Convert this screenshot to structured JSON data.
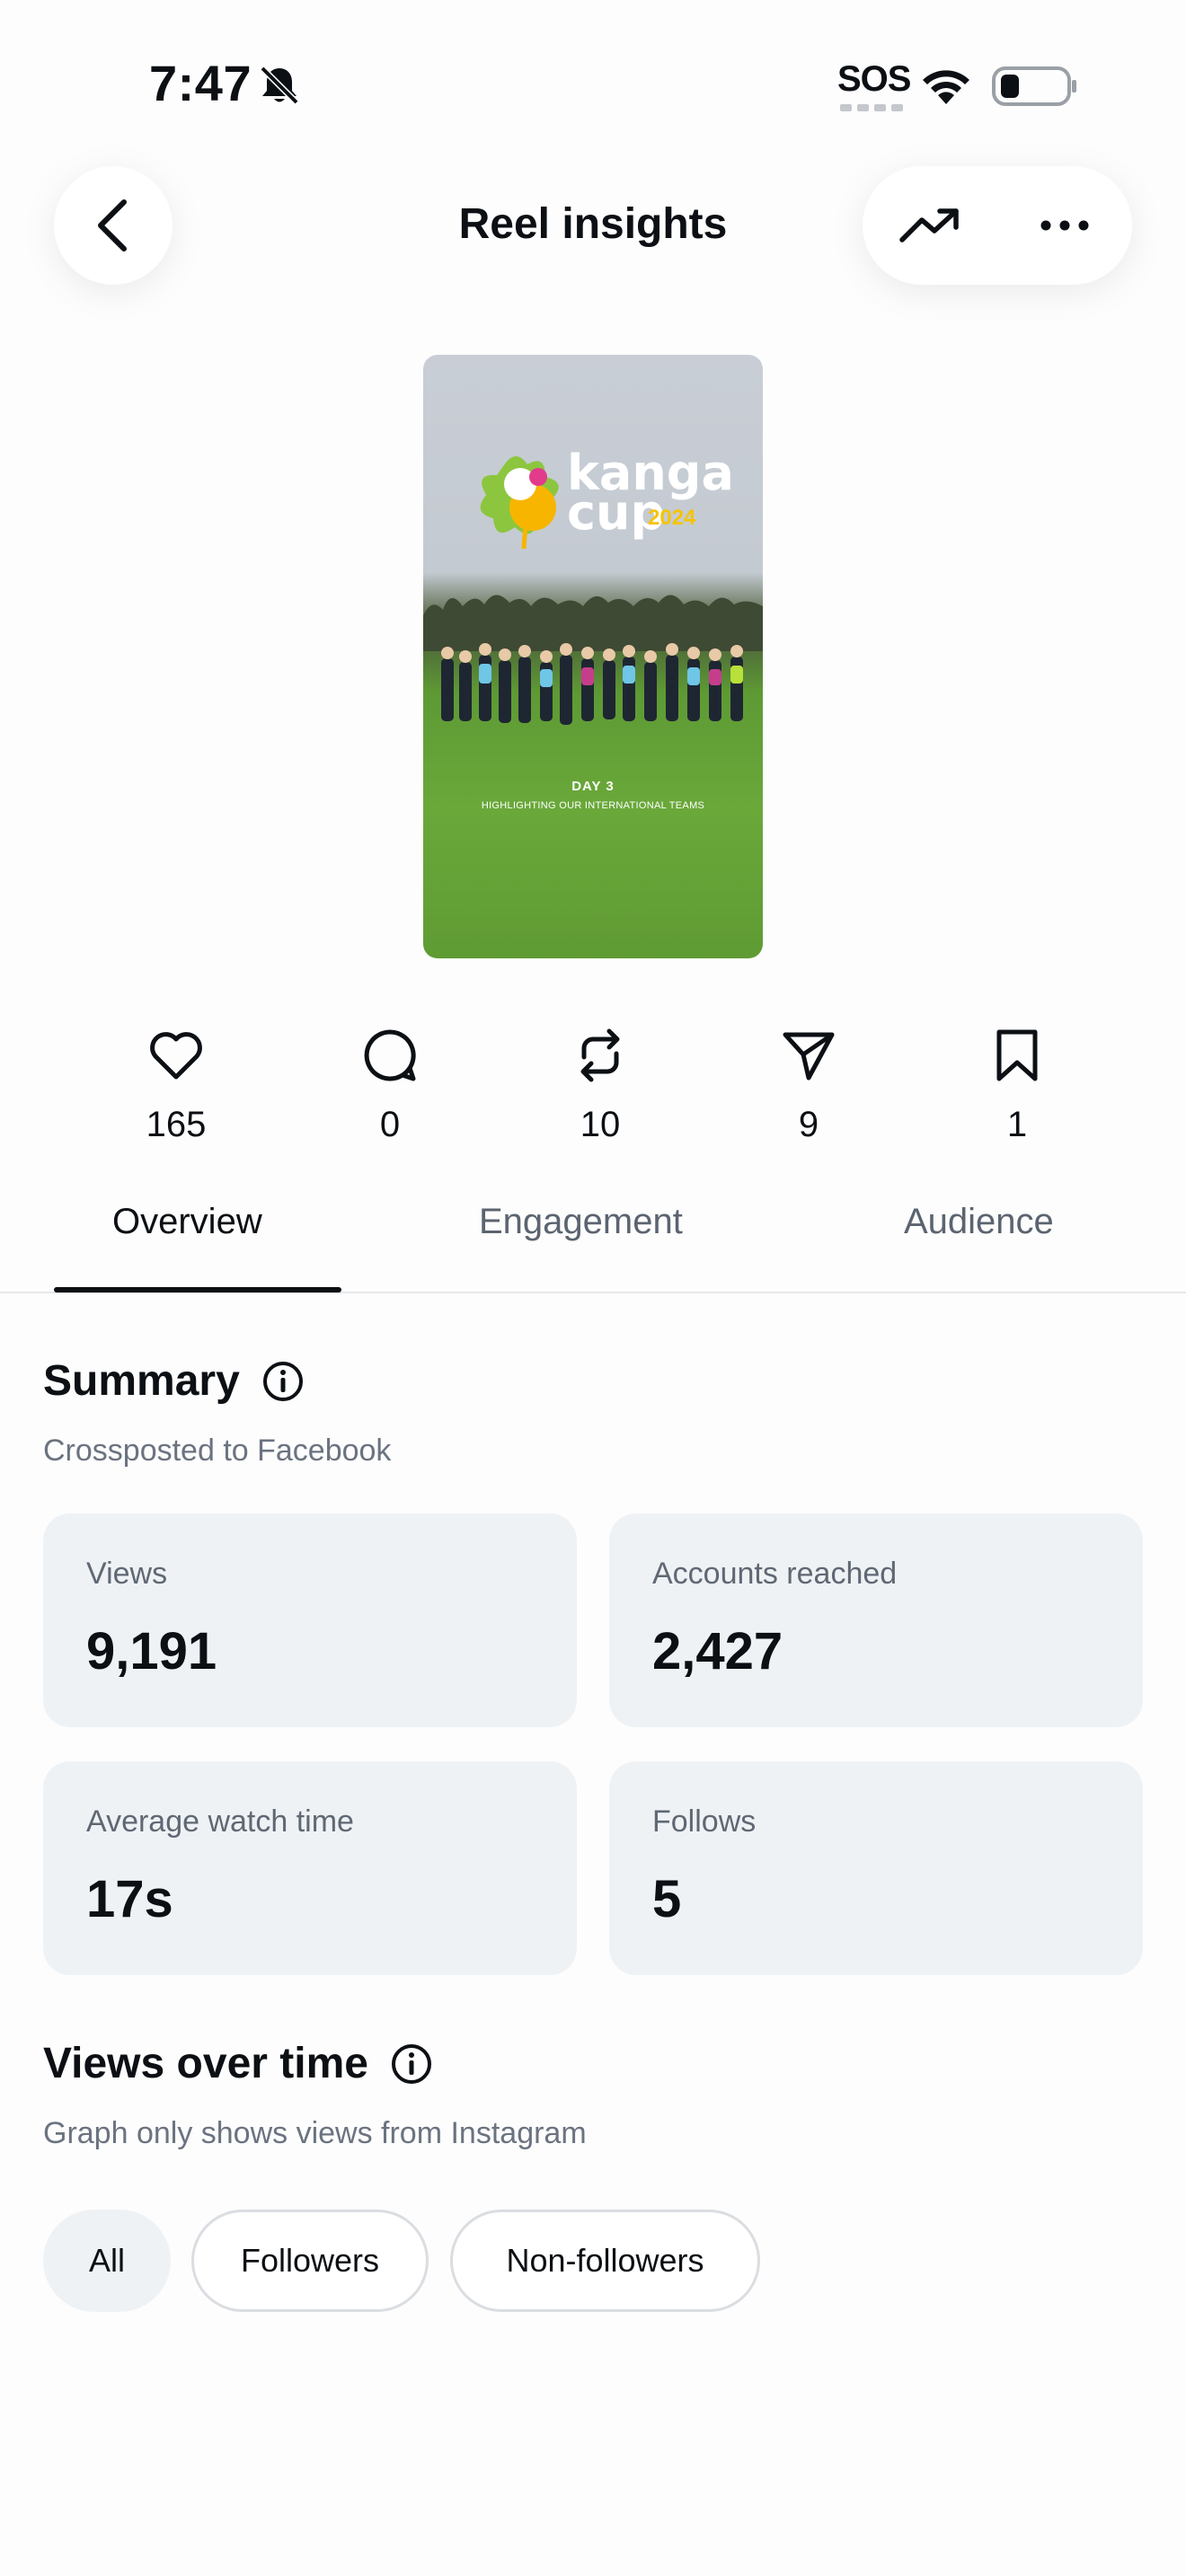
{
  "status_bar": {
    "time": "7:47",
    "sos": "SOS",
    "bell_icon": "bell-slash-icon",
    "wifi_icon": "wifi-icon",
    "battery_icon": "battery-low-icon"
  },
  "header": {
    "title": "Reel insights",
    "back_icon": "chevron-left-icon",
    "trend_icon": "trending-up-icon",
    "more_icon": "more-horizontal-icon"
  },
  "thumbnail": {
    "brand_line1": "kanga",
    "brand_line2": "cup",
    "brand_year": "2024",
    "day": "DAY 3",
    "caption": "HIGHLIGHTING OUR INTERNATIONAL TEAMS"
  },
  "metrics": [
    {
      "icon": "heart-icon",
      "value": "165"
    },
    {
      "icon": "comment-icon",
      "value": "0"
    },
    {
      "icon": "repost-icon",
      "value": "10"
    },
    {
      "icon": "share-icon",
      "value": "9"
    },
    {
      "icon": "bookmark-icon",
      "value": "1"
    }
  ],
  "tabs": [
    {
      "label": "Overview",
      "active": true
    },
    {
      "label": "Engagement",
      "active": false
    },
    {
      "label": "Audience",
      "active": false
    }
  ],
  "summary": {
    "title": "Summary",
    "subtitle": "Crossposted to Facebook",
    "cards": [
      {
        "label": "Views",
        "value": "9,191"
      },
      {
        "label": "Accounts reached",
        "value": "2,427"
      },
      {
        "label": "Average watch time",
        "value": "17s"
      },
      {
        "label": "Follows",
        "value": "5"
      }
    ]
  },
  "views_over_time": {
    "title": "Views over time",
    "subtitle": "Graph only shows views from Instagram",
    "filters": [
      {
        "label": "All",
        "selected": true
      },
      {
        "label": "Followers",
        "selected": false
      },
      {
        "label": "Non-followers",
        "selected": false
      }
    ]
  },
  "colors": {
    "text": "#0c1014",
    "muted": "#6b7380",
    "card_bg": "#eff2f5",
    "divider": "#e6e8eb",
    "brand_yellow": "#f5c400"
  }
}
